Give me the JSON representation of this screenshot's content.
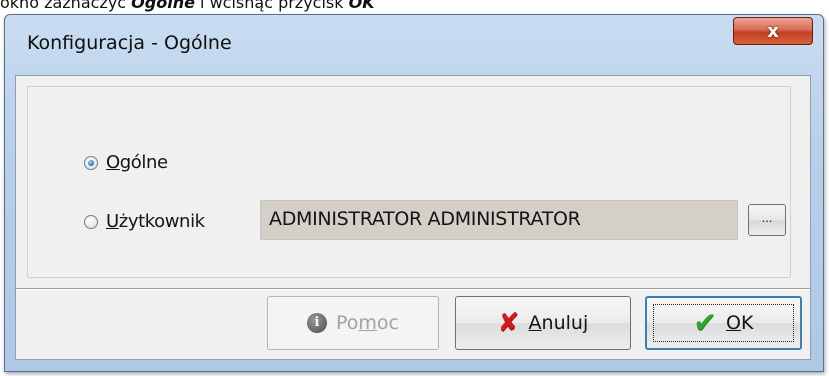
{
  "caption": {
    "prefix": "okno zaznaczyć",
    "bold1": "Ogólne",
    "middle": "i wciśnąć przycisk",
    "bold2": "OK"
  },
  "window": {
    "title": "Konfiguracja - Ogólne",
    "close_glyph": "x"
  },
  "options": {
    "general": {
      "before": "",
      "accel": "O",
      "after": "gólne",
      "checked": true
    },
    "user": {
      "before": "",
      "accel": "U",
      "after": "żytkownik",
      "checked": false
    },
    "user_value": "ADMINISTRATOR ADMINISTRATOR",
    "browse_label": "..."
  },
  "buttons": {
    "help": {
      "before": "Po",
      "accel": "m",
      "after": "oc",
      "icon": "info-icon",
      "enabled": false
    },
    "cancel": {
      "before": "",
      "accel": "A",
      "after": "nuluj",
      "icon": "x-icon"
    },
    "ok": {
      "before": "",
      "accel": "O",
      "after": "K",
      "icon": "check-icon",
      "default": true
    }
  },
  "colors": {
    "title_gradient": "#c9dcf1",
    "close_button": "#c33f22",
    "default_border": "#3c7fb1",
    "cancel_icon": "#d11a1a",
    "ok_icon": "#2ea52b"
  }
}
